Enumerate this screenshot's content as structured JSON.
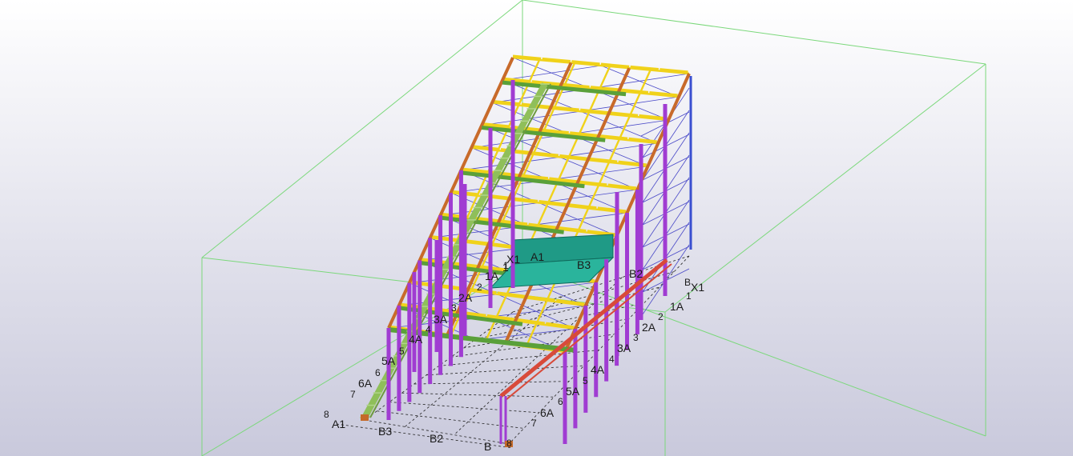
{
  "viewport": {
    "background_top": "#ffffff",
    "background_bottom": "#c9c9dc"
  },
  "colors": {
    "view_box": "#7bd87b",
    "gridline": "#222222",
    "column": "#a03cd2",
    "column_blue": "#3a4fd0",
    "rafter": "#c86a2a",
    "purlin": "#f0d21a",
    "girt_green": "#5aa03a",
    "bracing": "#4a4ac8",
    "stair": "#8fbf5a",
    "platform": "#1f9a86",
    "crane_beam": "#d84a3a",
    "foundation": "#c46a2a"
  },
  "grid_labels": {
    "left_end": [
      "8",
      "A1",
      "B3",
      "B2",
      "B"
    ],
    "front_axis": [
      "7",
      "6A",
      "6",
      "5A",
      "5",
      "4A",
      "4",
      "3A",
      "3",
      "2A",
      "2",
      "1A",
      "1"
    ],
    "right_axis": [
      "8",
      "7",
      "6A",
      "6",
      "5A",
      "5",
      "4A",
      "4",
      "3A",
      "3",
      "2A",
      "2",
      "1A",
      "1",
      "X1",
      "B"
    ],
    "top_markers": [
      "X1",
      "A1",
      "B3",
      "B2",
      "1"
    ]
  }
}
